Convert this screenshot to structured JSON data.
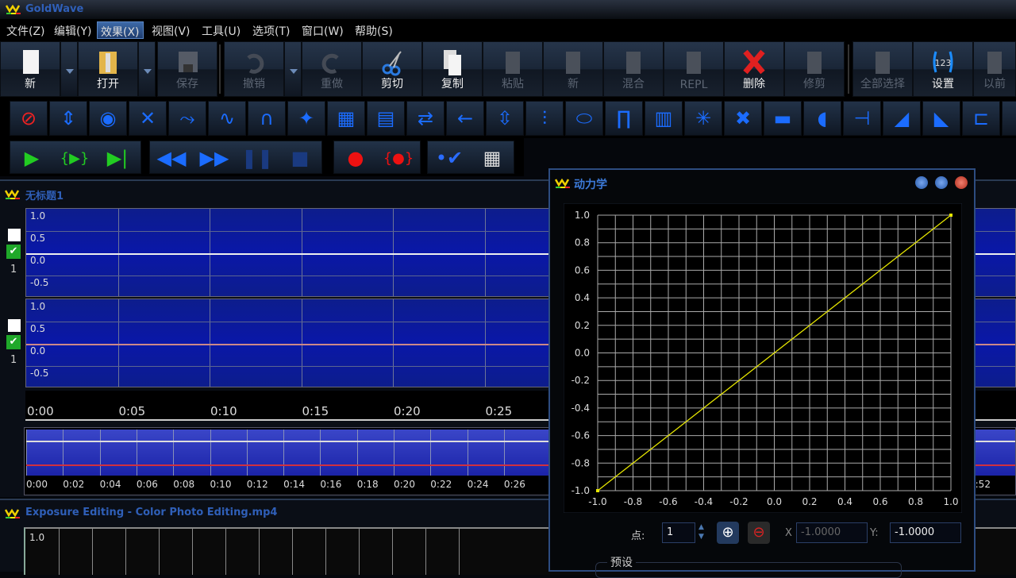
{
  "app": {
    "title": "GoldWave"
  },
  "menu": [
    {
      "label": "文件(Z)"
    },
    {
      "label": "编辑(Y)"
    },
    {
      "label": "效果(X)",
      "active": true
    },
    {
      "label": "视图(V)"
    },
    {
      "label": "工具(U)"
    },
    {
      "label": "选项(T)"
    },
    {
      "label": "窗口(W)"
    },
    {
      "label": "帮助(S)"
    }
  ],
  "toolbar": [
    {
      "label": "新",
      "icon": "new-file-icon",
      "enabled": true,
      "dropdown": true
    },
    {
      "label": "打开",
      "icon": "open-folder-icon",
      "enabled": true,
      "dropdown": true
    },
    {
      "label": "保存",
      "icon": "save-icon",
      "enabled": false
    },
    {
      "label": "撤销",
      "icon": "undo-icon",
      "enabled": false,
      "dropdown": true
    },
    {
      "label": "重做",
      "icon": "redo-icon",
      "enabled": false
    },
    {
      "label": "剪切",
      "icon": "scissors-icon",
      "enabled": true
    },
    {
      "label": "复制",
      "icon": "copy-icon",
      "enabled": true
    },
    {
      "label": "粘贴",
      "icon": "paste-icon",
      "enabled": false
    },
    {
      "label": "新",
      "icon": "paste-new-icon",
      "enabled": false
    },
    {
      "label": "混合",
      "icon": "mix-icon",
      "enabled": false
    },
    {
      "label": "REPL",
      "icon": "replace-icon",
      "enabled": false
    },
    {
      "label": "删除",
      "icon": "delete-icon",
      "enabled": true
    },
    {
      "label": "修剪",
      "icon": "trim-icon",
      "enabled": false
    },
    {
      "label": "全部选择",
      "icon": "select-all-icon",
      "enabled": false
    },
    {
      "label": "设置",
      "icon": "set-selection-icon",
      "enabled": true
    },
    {
      "label": "以前",
      "icon": "previous-icon",
      "enabled": false
    }
  ],
  "effects": [
    "stop-effect-icon",
    "auto-gain-icon",
    "bass-boost-icon",
    "cross-fade-icon",
    "channel-mixer-icon",
    "doppler-icon",
    "echo-icon",
    "compressor-icon",
    "equalizer-icon",
    "filter-icon",
    "flanger-icon",
    "back-icon",
    "fade-in-out-icon",
    "mixer-sliders-icon",
    "band-eq-icon",
    "spectrum-filter-icon",
    "noise-icon",
    "pop-click-icon",
    "noise-reduction-icon",
    "pitch-icon",
    "volume-icon",
    "volume-shape-icon",
    "fade-in-icon",
    "fade-out-icon",
    "matcher-icon",
    "more-icon"
  ],
  "transport": {
    "groups": [
      [
        "play-icon",
        "play-selection-icon",
        "play-from-cursor-icon"
      ],
      [
        "rewind-icon",
        "fast-forward-icon",
        "pause-icon",
        "stop-icon"
      ],
      [
        "record-icon",
        "record-selection-icon"
      ],
      [
        "device-controls-icon",
        "control-window-icon"
      ]
    ]
  },
  "wave_window": {
    "title": "无标题1",
    "channels": [
      {
        "number": "1",
        "y_labels": [
          "1.0",
          "0.5",
          "0.0",
          "-0.5"
        ]
      },
      {
        "number": "1",
        "y_labels": [
          "1.0",
          "0.5",
          "0.0",
          "-0.5"
        ]
      }
    ],
    "timeline": [
      "0:00",
      "0:05",
      "0:10",
      "0:15",
      "0:20",
      "0:25"
    ],
    "overview_timeline": [
      "0:00",
      "0:02",
      "0:04",
      "0:06",
      "0:08",
      "0:10",
      "0:12",
      "0:14",
      "0:16",
      "0:18",
      "0:20",
      "0:22",
      "0:24",
      "0:26",
      "0:52"
    ]
  },
  "bottom_window": {
    "title": "Exposure Editing - Color Photo Editing.mp4",
    "y_label": "1.0"
  },
  "dialog": {
    "title": "动力学",
    "point_label": "点:",
    "point_value": "1",
    "x_label": "X",
    "x_value": "-1.0000",
    "y_label": "Y:",
    "y_value": "-1.0000",
    "preset_label": "预设"
  },
  "chart_data": {
    "type": "line",
    "xlim": [
      -1,
      1
    ],
    "ylim": [
      -1,
      1
    ],
    "grid": true,
    "x_ticks": [
      "-1.0",
      "-0.8",
      "-0.6",
      "-0.4",
      "-0.2",
      "0.0",
      "0.2",
      "0.4",
      "0.6",
      "0.8",
      "1.0"
    ],
    "y_ticks": [
      "1.0",
      "0.8",
      "0.6",
      "0.4",
      "0.2",
      "0.0",
      "-0.2",
      "-0.4",
      "-0.6",
      "-0.8",
      "-1.0"
    ],
    "series": [
      {
        "points": [
          [
            -1,
            -1
          ],
          [
            1,
            1
          ]
        ],
        "color": "#e6e600"
      }
    ]
  },
  "colors": {
    "accent": "#2f5fb8",
    "wave_bg": "#0a17a8",
    "curve": "#e6e600"
  }
}
